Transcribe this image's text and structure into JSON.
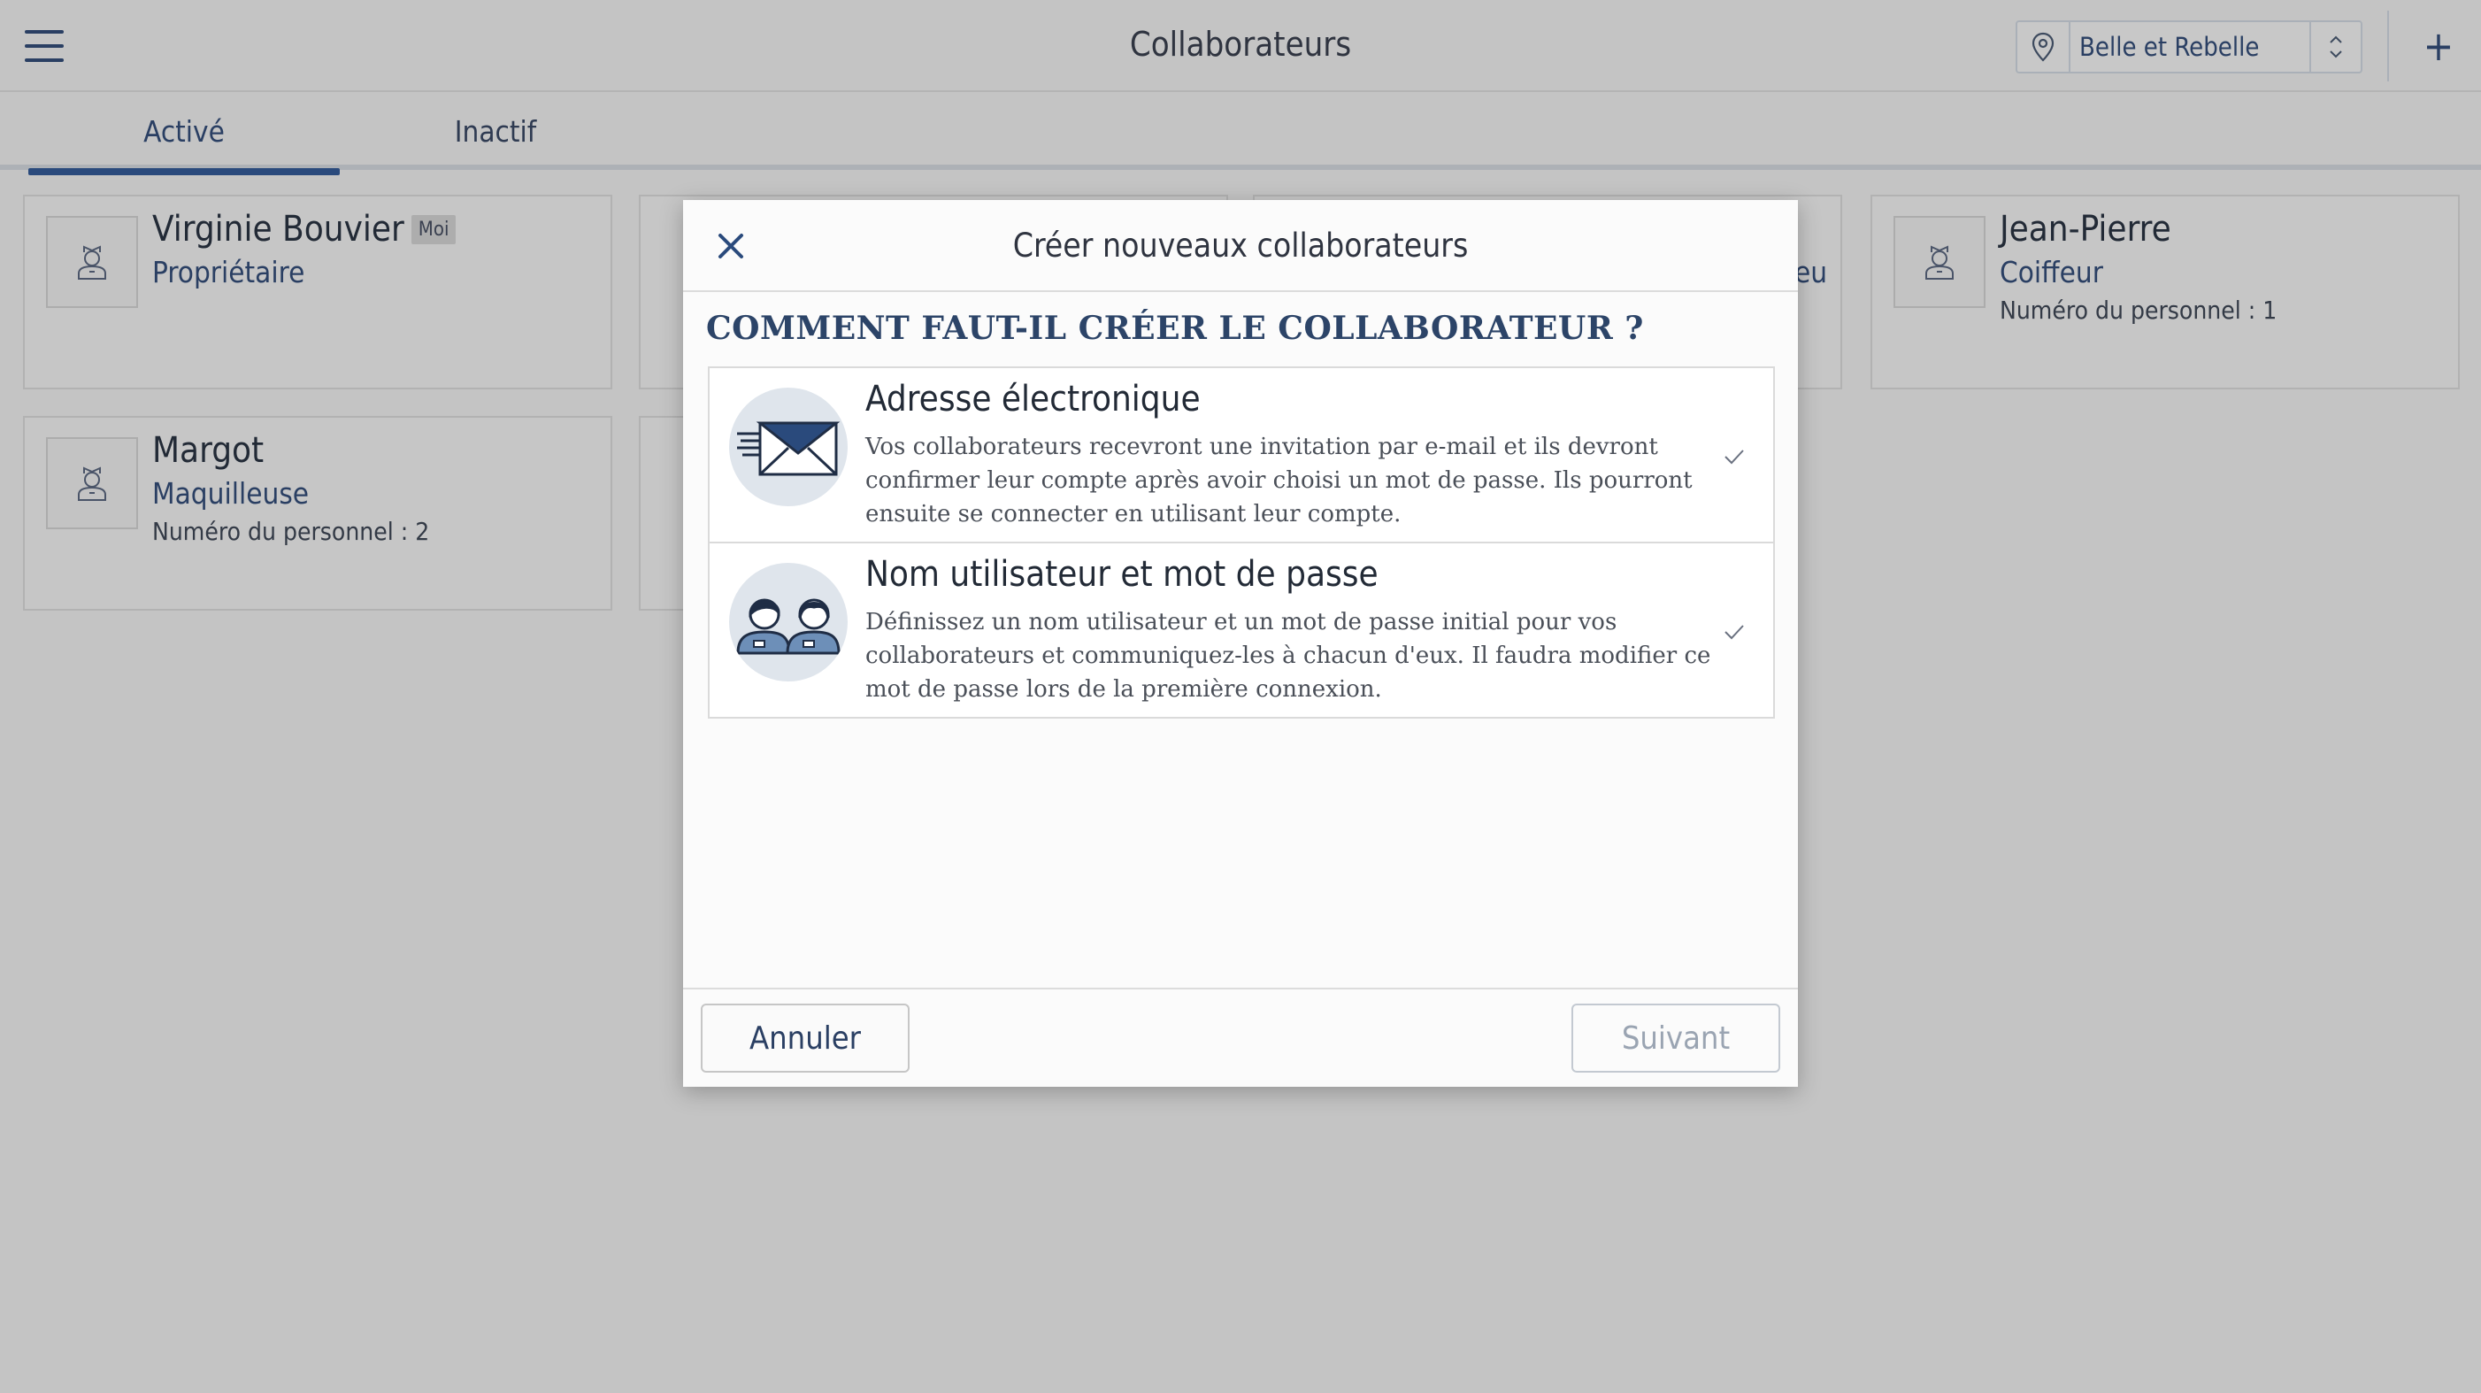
{
  "header": {
    "title": "Collaborateurs",
    "location": "Belle et Rebelle",
    "add_label": "+"
  },
  "tabs": [
    {
      "label": "Activé",
      "active": true
    },
    {
      "label": "Inactif",
      "active": false
    }
  ],
  "staff": [
    {
      "name": "Virginie Bouvier",
      "badge": "Moi",
      "role": "Propriétaire",
      "staff_no": ""
    },
    {
      "name": "Jean-Pierre",
      "role": "Coiffeur",
      "staff_no": "Numéro du personnel : 1"
    },
    {
      "name": "Margot",
      "role": "Maquilleuse",
      "staff_no": "Numéro du personnel : 2"
    },
    {
      "role_partial": "eu"
    }
  ],
  "modal": {
    "title": "Créer nouveaux collaborateurs",
    "question": "COMMENT FAUT-IL CRÉER LE COLLABORATEUR ?",
    "options": [
      {
        "title": "Adresse électronique",
        "description": "Vos collaborateurs recevront une invitation par e-mail et ils devront confirmer leur compte après avoir choisi un mot de passe. Ils pourront ensuite se connecter en utilisant leur compte.",
        "icon": "envelope-icon"
      },
      {
        "title": "Nom utilisateur et mot de passe",
        "description": "Définissez un nom utilisateur et un mot de passe initial pour vos collaborateurs et communiquez-les à chacun d'eux. Il faudra modifier ce mot de passe lors de la première connexion.",
        "icon": "users-icon"
      }
    ],
    "cancel_label": "Annuler",
    "next_label": "Suivant"
  },
  "colors": {
    "accent": "#2a4a7c",
    "overlay_bg": "#c4c4c4",
    "modal_bg": "#fbfbfb",
    "disabled_text": "#9aa4b2"
  }
}
